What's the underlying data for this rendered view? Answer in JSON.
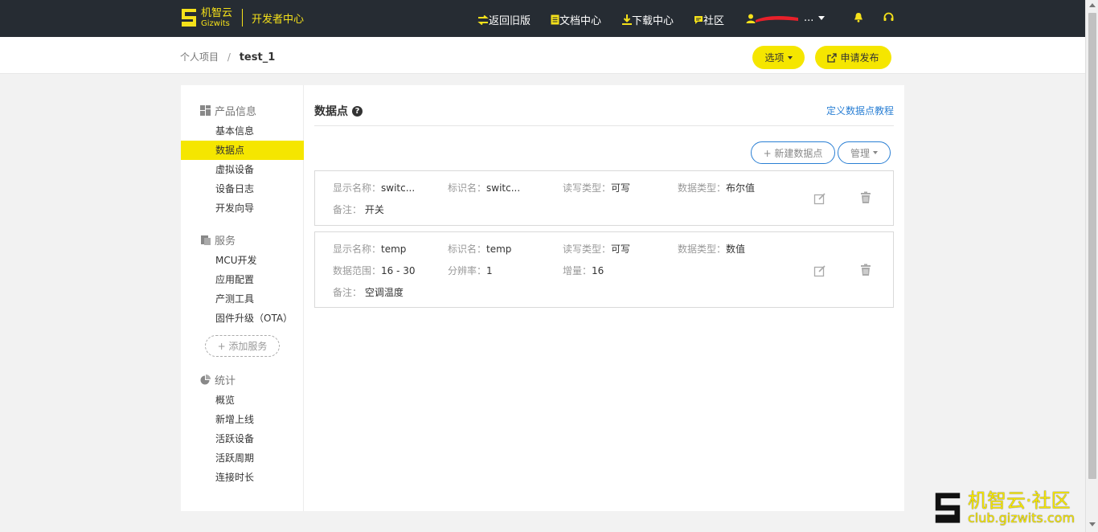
{
  "brand": {
    "name_cn": "机智云",
    "name_en": "Gizwits",
    "subtitle": "开发者中心",
    "color": "#f5e11a"
  },
  "topnav": {
    "items": [
      {
        "label": "返回旧版",
        "icon": "swap-icon"
      },
      {
        "label": "文档中心",
        "icon": "document-icon"
      },
      {
        "label": "下载中心",
        "icon": "download-icon"
      },
      {
        "label": "社区",
        "icon": "chat-icon"
      }
    ],
    "user_name": "..."
  },
  "breadcrumb": {
    "parent": "个人项目",
    "separator": "/",
    "current": "test_1"
  },
  "actions": {
    "options_label": "选项",
    "publish_label": "申请发布"
  },
  "sidebar": {
    "sections": [
      {
        "title": "产品信息",
        "items": [
          "基本信息",
          "数据点",
          "虚拟设备",
          "设备日志",
          "开发向导"
        ]
      },
      {
        "title": "服务",
        "items": [
          "MCU开发",
          "应用配置",
          "产测工具",
          "固件升级（OTA）"
        ]
      },
      {
        "title": "统计",
        "items": [
          "概览",
          "新增上线",
          "活跃设备",
          "活跃周期",
          "连接时长"
        ]
      }
    ],
    "active_item": "数据点",
    "add_service_label": "+ 添加服务"
  },
  "main": {
    "title": "数据点",
    "help_mark": "?",
    "tutorial_link": "定义数据点教程",
    "new_button": "+ 新建数据点",
    "manage_button": "管理"
  },
  "datapoints": [
    {
      "display_name_label": "显示名称：",
      "display_name": "switc...",
      "id_label": "标识名：",
      "id": "switc...",
      "rw_label": "读写类型：",
      "rw": "可写",
      "type_label": "数据类型：",
      "type": "布尔值",
      "note_label": "备注：",
      "note": "开关"
    },
    {
      "display_name_label": "显示名称：",
      "display_name": "temp",
      "id_label": "标识名：",
      "id": "temp",
      "rw_label": "读写类型：",
      "rw": "可写",
      "type_label": "数据类型：",
      "type": "数值",
      "range_label": "数据范围：",
      "range": "16 - 30",
      "resolution_label": "分辨率：",
      "resolution": "1",
      "increment_label": "增量：",
      "increment": "16",
      "note_label": "备注：",
      "note": "空调温度"
    }
  ],
  "watermark": {
    "cn": "机智云·社区",
    "en": "club.gizwits.com"
  }
}
